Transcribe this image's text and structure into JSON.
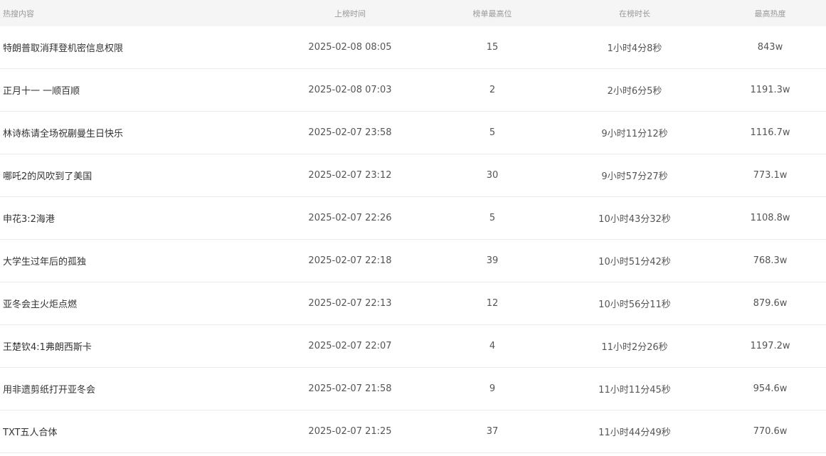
{
  "headers": {
    "title": "热搜内容",
    "time": "上榜时间",
    "rank": "榜单最高位",
    "duration": "在榜时长",
    "heat": "最高热度"
  },
  "rows": [
    {
      "title": "特朗普取消拜登机密信息权限",
      "time": "2025-02-08 08:05",
      "rank": "15",
      "duration": "1小时4分8秒",
      "heat": "843w"
    },
    {
      "title": "正月十一 一顺百顺",
      "time": "2025-02-08 07:03",
      "rank": "2",
      "duration": "2小时6分5秒",
      "heat": "1191.3w"
    },
    {
      "title": "林诗栋请全场祝蒯曼生日快乐",
      "time": "2025-02-07 23:58",
      "rank": "5",
      "duration": "9小时11分12秒",
      "heat": "1116.7w"
    },
    {
      "title": "哪吒2的风吹到了美国",
      "time": "2025-02-07 23:12",
      "rank": "30",
      "duration": "9小时57分27秒",
      "heat": "773.1w"
    },
    {
      "title": "申花3:2海港",
      "time": "2025-02-07 22:26",
      "rank": "5",
      "duration": "10小时43分32秒",
      "heat": "1108.8w"
    },
    {
      "title": "大学生过年后的孤独",
      "time": "2025-02-07 22:18",
      "rank": "39",
      "duration": "10小时51分42秒",
      "heat": "768.3w"
    },
    {
      "title": "亚冬会主火炬点燃",
      "time": "2025-02-07 22:13",
      "rank": "12",
      "duration": "10小时56分11秒",
      "heat": "879.6w"
    },
    {
      "title": "王楚钦4:1弗朗西斯卡",
      "time": "2025-02-07 22:07",
      "rank": "4",
      "duration": "11小时2分26秒",
      "heat": "1197.2w"
    },
    {
      "title": "用非遗剪纸打开亚冬会",
      "time": "2025-02-07 21:58",
      "rank": "9",
      "duration": "11小时11分45秒",
      "heat": "954.6w"
    },
    {
      "title": "TXT五人合体",
      "time": "2025-02-07 21:25",
      "rank": "37",
      "duration": "11小时44分49秒",
      "heat": "770.6w"
    }
  ]
}
